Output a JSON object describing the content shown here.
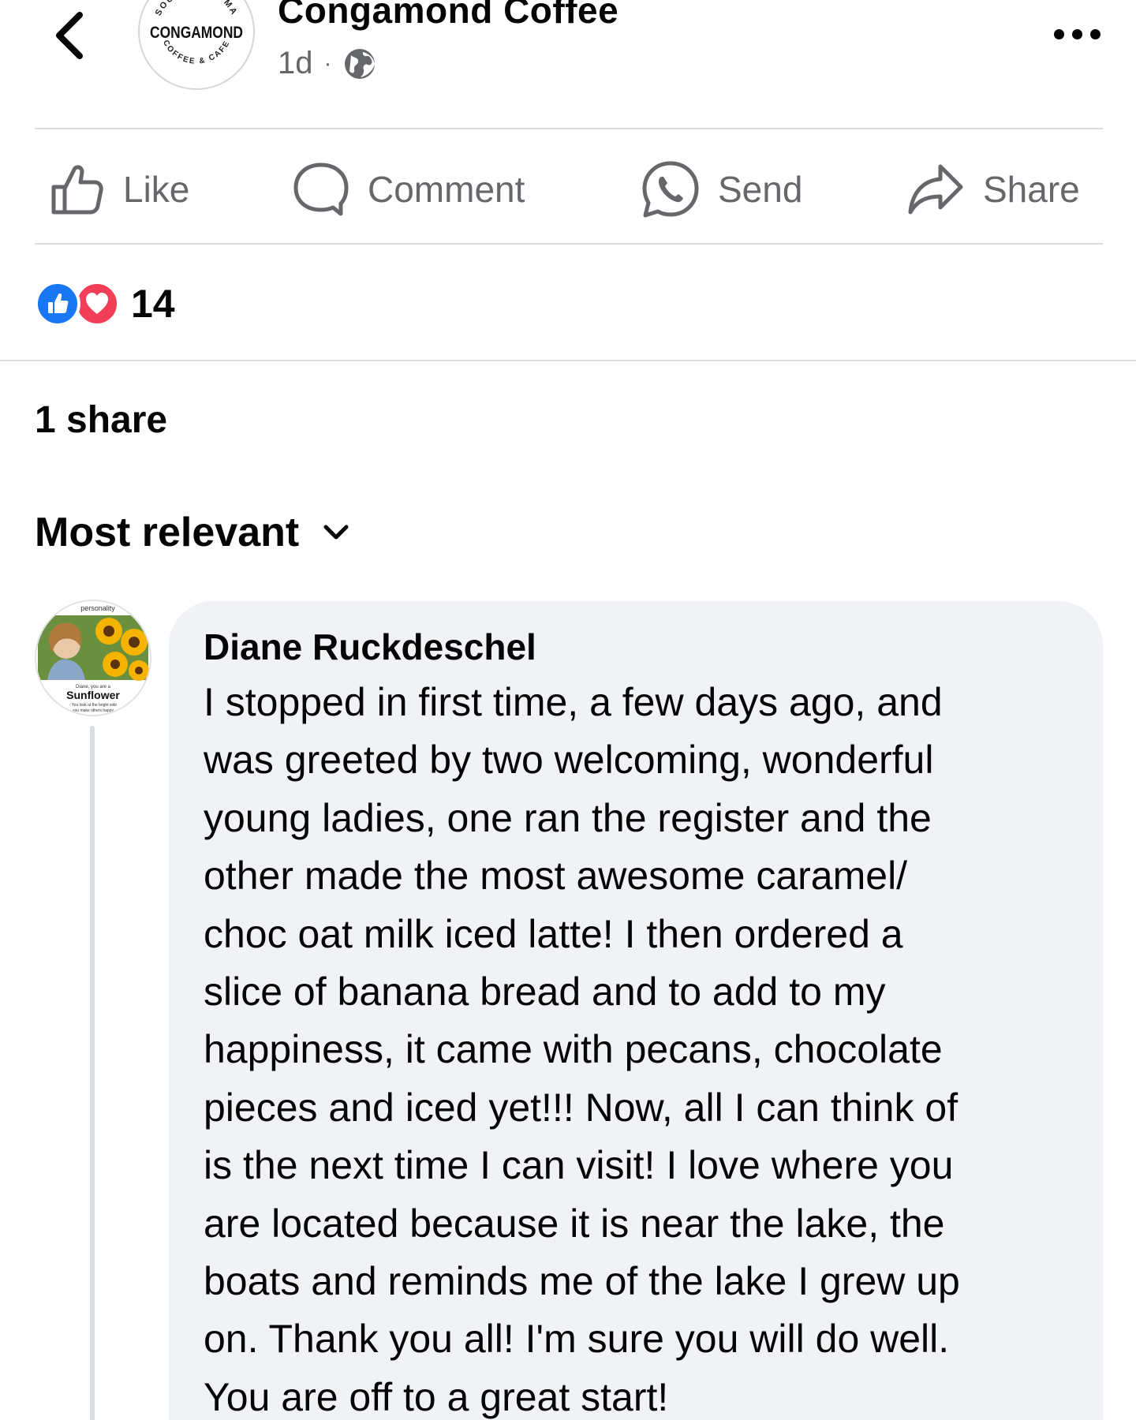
{
  "header": {
    "page_name": "Congamond Coffee",
    "time_ago": "1d",
    "separator": "·",
    "logo": {
      "wordmark": "CONGAMOND",
      "top_arc": "SOUTHWICK, MA",
      "bottom_arc": "COFFEE & CAFE"
    }
  },
  "actions": {
    "like": "Like",
    "comment": "Comment",
    "send": "Send",
    "share": "Share"
  },
  "reactions": {
    "count": "14",
    "types": [
      "like",
      "love"
    ],
    "colors": {
      "like": "#1877f2",
      "love": "#f33e58"
    }
  },
  "shares_text": "1 share",
  "sort_label": "Most relevant",
  "comment": {
    "author": "Diane Ruckdeschel",
    "avatar_frame": {
      "top_text": "personality",
      "caption_small": "Diane, you are a",
      "caption_title": "Sunflower",
      "caption_line1": "- You look at the bright side",
      "caption_line2": "you make others happy"
    },
    "lines": [
      "I stopped in first time, a few days ago, and",
      "was greeted by two welcoming, wonderful",
      "young ladies, one ran the register and the",
      "other made the most awesome caramel/",
      "choc oat milk iced latte!   I then ordered a",
      "slice of banana bread and to add to my",
      "happiness, it came with pecans, chocolate",
      "pieces and iced yet!!!  Now, all I can think of",
      "is the next time I can visit!  I love where you",
      "are located because it is near the lake, the",
      "boats and reminds me of the lake I grew up",
      "on.  Thank you all!  I'm sure you will do well.",
      "You are off to a great start!"
    ]
  },
  "colors": {
    "text_primary": "#050505",
    "text_secondary": "#65676b",
    "divider": "#dadde1",
    "bubble_bg": "#f0f2f5"
  },
  "icons": [
    "back-arrow-icon",
    "globe-icon",
    "more-icon",
    "thumbs-up-icon",
    "comment-icon",
    "whatsapp-icon",
    "share-arrow-icon",
    "like-reaction-icon",
    "love-reaction-icon",
    "chevron-down-icon"
  ]
}
